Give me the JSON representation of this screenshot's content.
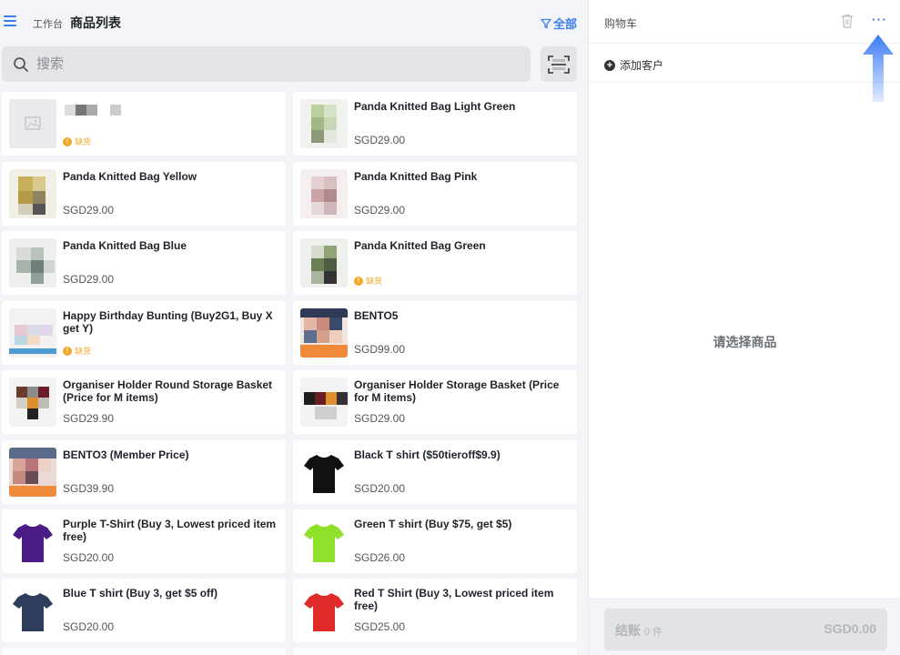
{
  "header": {
    "breadcrumb": "工作台",
    "title": "商品列表",
    "filter_label": "全部"
  },
  "search": {
    "placeholder": "搜索"
  },
  "products": [
    {
      "name": "",
      "price": "",
      "status": "缺货"
    },
    {
      "name": "Panda Knitted Bag Light Green",
      "price": "SGD29.00",
      "status": ""
    },
    {
      "name": "Panda Knitted Bag Yellow",
      "price": "SGD29.00",
      "status": ""
    },
    {
      "name": "Panda Knitted Bag Pink",
      "price": "SGD29.00",
      "status": ""
    },
    {
      "name": "Panda Knitted Bag Blue",
      "price": "SGD29.00",
      "status": ""
    },
    {
      "name": "Panda Knitted Bag Green",
      "price": "",
      "status": "缺货"
    },
    {
      "name": "Happy Birthday Bunting (Buy2G1, Buy X get Y)",
      "price": "",
      "status": "缺货"
    },
    {
      "name": "BENTO5",
      "price": "SGD99.00",
      "status": ""
    },
    {
      "name": "Organiser Holder Round Storage Basket (Price for M items)",
      "price": "SGD29.90",
      "status": ""
    },
    {
      "name": "Organiser Holder Storage Basket (Price for M items)",
      "price": "SGD29.00",
      "status": ""
    },
    {
      "name": "BENTO3 (Member Price)",
      "price": "SGD39.90",
      "status": ""
    },
    {
      "name": "Black T shirt ($50tieroff$9.9)",
      "price": "SGD20.00",
      "status": ""
    },
    {
      "name": "Purple T-Shirt (Buy 3, Lowest priced item free)",
      "price": "SGD20.00",
      "status": ""
    },
    {
      "name": "Green T shirt (Buy $75, get $5)",
      "price": "SGD26.00",
      "status": ""
    },
    {
      "name": "Blue T shirt (Buy 3, get $5 off)",
      "price": "SGD20.00",
      "status": ""
    },
    {
      "name": "Red T Shirt (Buy 3, Lowest priced item free)",
      "price": "SGD25.00",
      "status": ""
    }
  ],
  "cart": {
    "title": "购物车",
    "add_customer": "添加客户",
    "empty_message": "请选择商品",
    "checkout_label": "结账",
    "checkout_count": "0 件",
    "checkout_amount": "SGD0.00"
  },
  "colors": {
    "accent": "#3b7cf4",
    "warning": "#f5a623",
    "tshirt_black": "#111111",
    "tshirt_purple": "#4b1c86",
    "tshirt_green": "#8ee02a",
    "tshirt_blue": "#2f3d5c",
    "tshirt_red": "#e02a2a"
  },
  "icons": [
    "menu-icon",
    "filter-icon",
    "search-icon",
    "scan-icon",
    "trash-icon",
    "more-icon",
    "add-circle-icon",
    "warning-icon",
    "arrow-up-icon"
  ]
}
